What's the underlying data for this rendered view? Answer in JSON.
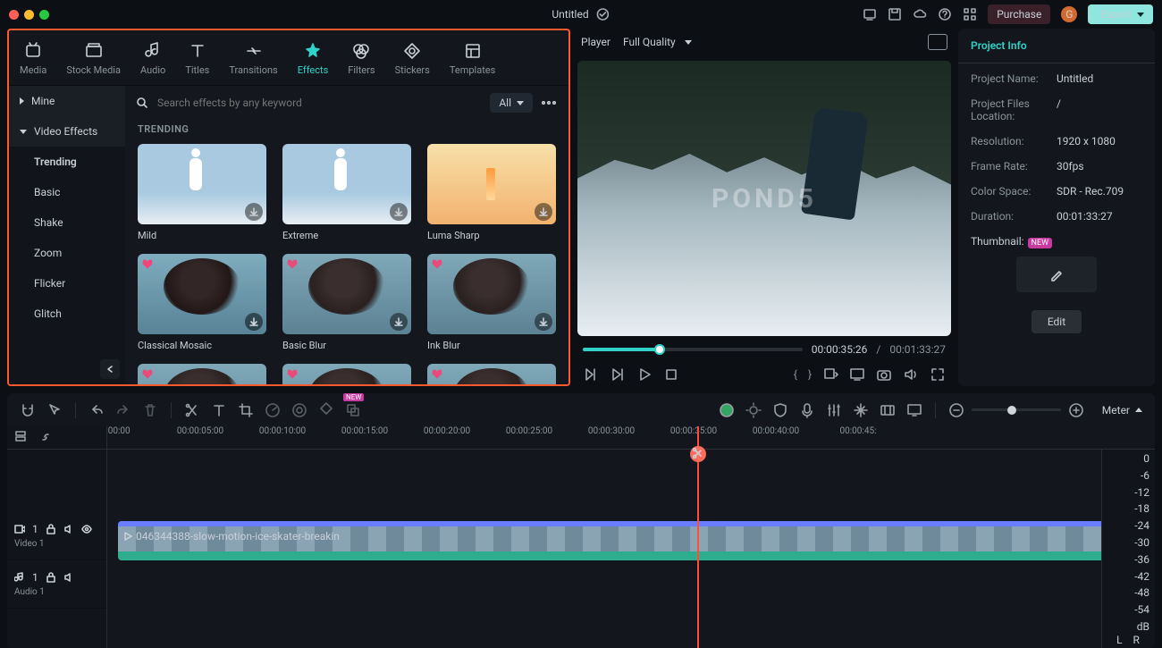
{
  "titlebar": {
    "project_title": "Untitled",
    "purchase_label": "Purchase",
    "export_label": "Export",
    "avatar_letter": "G"
  },
  "tabs": [
    {
      "id": "media",
      "label": "Media"
    },
    {
      "id": "stock-media",
      "label": "Stock Media"
    },
    {
      "id": "audio",
      "label": "Audio"
    },
    {
      "id": "titles",
      "label": "Titles"
    },
    {
      "id": "transitions",
      "label": "Transitions"
    },
    {
      "id": "effects",
      "label": "Effects"
    },
    {
      "id": "filters",
      "label": "Filters"
    },
    {
      "id": "stickers",
      "label": "Stickers"
    },
    {
      "id": "templates",
      "label": "Templates"
    }
  ],
  "active_tab": "effects",
  "side_categories": {
    "mine": "Mine",
    "video_effects": "Video Effects",
    "subs": [
      "Trending",
      "Basic",
      "Shake",
      "Zoom",
      "Flicker",
      "Glitch"
    ],
    "active_sub": "Trending"
  },
  "search": {
    "placeholder": "Search effects by any keyword",
    "filter_label": "All"
  },
  "effects_section": {
    "heading": "TRENDING"
  },
  "effects": [
    {
      "label": "Mild",
      "kind": "sky",
      "premium": false
    },
    {
      "label": "Extreme",
      "kind": "sky",
      "premium": false
    },
    {
      "label": "Luma Sharp",
      "kind": "orange",
      "premium": false
    },
    {
      "label": "Classical Mosaic",
      "kind": "pix",
      "premium": true
    },
    {
      "label": "Basic Blur",
      "kind": "person",
      "premium": true
    },
    {
      "label": "Ink Blur",
      "kind": "person",
      "premium": true
    },
    {
      "label": "",
      "kind": "person",
      "premium": true
    },
    {
      "label": "",
      "kind": "person",
      "premium": true
    },
    {
      "label": "",
      "kind": "person",
      "premium": true
    }
  ],
  "player": {
    "tab_player": "Player",
    "quality": "Full Quality",
    "watermark": "POND5",
    "current_time": "00:00:35:26",
    "separator": "/",
    "total_time": "00:01:33:27"
  },
  "info": {
    "heading": "Project Info",
    "rows": {
      "project_name": {
        "k": "Project Name:",
        "v": "Untitled"
      },
      "location": {
        "k": "Project Files Location:",
        "v": "/"
      },
      "resolution": {
        "k": "Resolution:",
        "v": "1920 x 1080"
      },
      "frame_rate": {
        "k": "Frame Rate:",
        "v": "30fps"
      },
      "color_space": {
        "k": "Color Space:",
        "v": "SDR - Rec.709"
      },
      "duration": {
        "k": "Duration:",
        "v": "00:01:33:27"
      },
      "thumbnail": {
        "k": "Thumbnail:",
        "badge": "NEW"
      }
    },
    "edit_label": "Edit"
  },
  "timeline": {
    "ruler": [
      ":00:00",
      "00:00:05:00",
      "00:00:10:00",
      "00:00:15:00",
      "00:00:20:00",
      "00:00:25:00",
      "00:00:30:00",
      "00:00:35:00",
      "00:00:40:00",
      "00:00:45:"
    ],
    "video_track": {
      "label": "Video 1",
      "index": "1"
    },
    "audio_track": {
      "label": "Audio 1",
      "index": "1"
    },
    "clip_name": "046344388-slow-motion-ice-skater-breakin",
    "meter_label": "Meter",
    "db_values": [
      "0",
      "-6",
      "-12",
      "-18",
      "-24",
      "-30",
      "-36",
      "-42",
      "-48",
      "-54",
      "dB"
    ],
    "lr": {
      "l": "L",
      "r": "R"
    }
  }
}
